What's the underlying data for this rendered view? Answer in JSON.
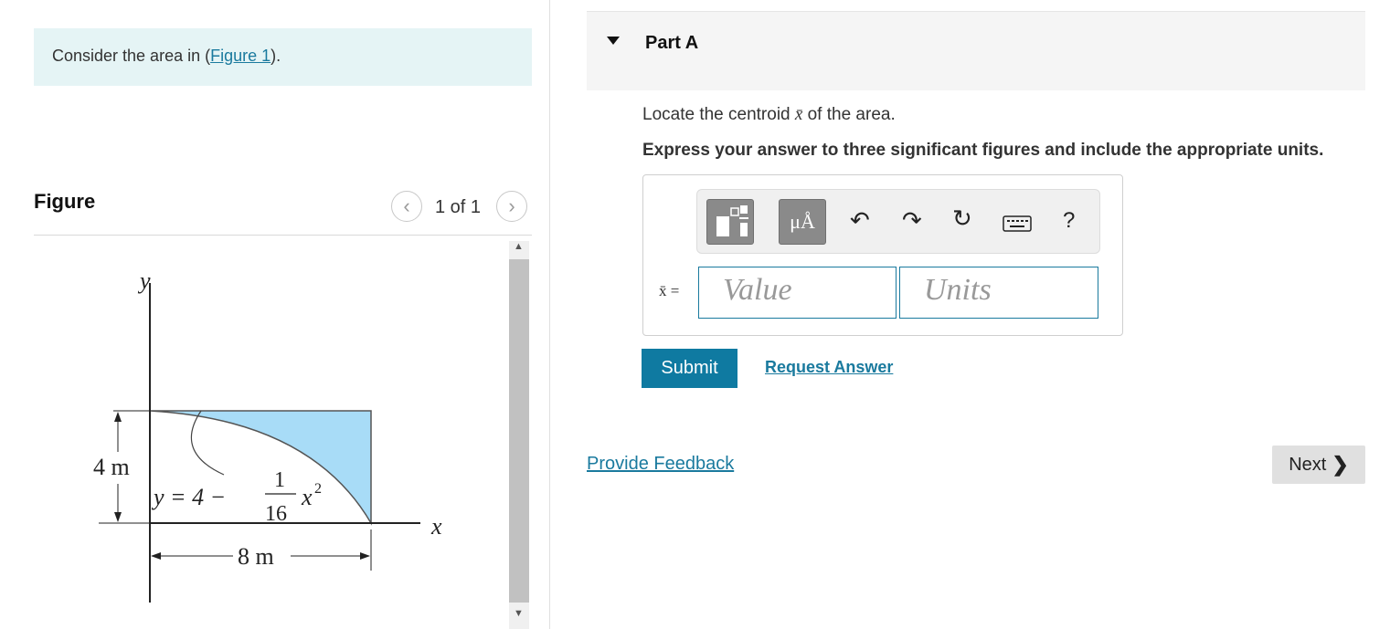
{
  "prompt": {
    "text_before": "Consider the area in (",
    "link": "Figure 1",
    "text_after": ")."
  },
  "figure": {
    "title": "Figure",
    "pager": "1 of 1",
    "fill_color": "#a8dcf7",
    "labels": {
      "y_axis": "y",
      "x_axis": "x",
      "height": "4 m",
      "width": "8 m",
      "eq_lhs": "y = 4 −",
      "eq_num": "1",
      "eq_den": "16",
      "eq_x": "x",
      "eq_exp": "2"
    }
  },
  "part": {
    "title": "Part A",
    "question_before": "Locate the centroid ",
    "question_symbol": "x̄",
    "question_after": " of the area.",
    "instruction": "Express your answer to three significant figures and include the appropriate units.",
    "toolbar": {
      "units_label": "μÅ",
      "help_label": "?"
    },
    "eq_label": "x̄ =",
    "value_placeholder": "Value",
    "units_placeholder": "Units",
    "submit_label": "Submit",
    "request_label": "Request Answer"
  },
  "feedback_label": "Provide Feedback",
  "next_label": "Next",
  "colors": {
    "accent": "#0f7aa1",
    "link": "#1a7a9e",
    "prompt_bg": "#e5f4f5"
  }
}
